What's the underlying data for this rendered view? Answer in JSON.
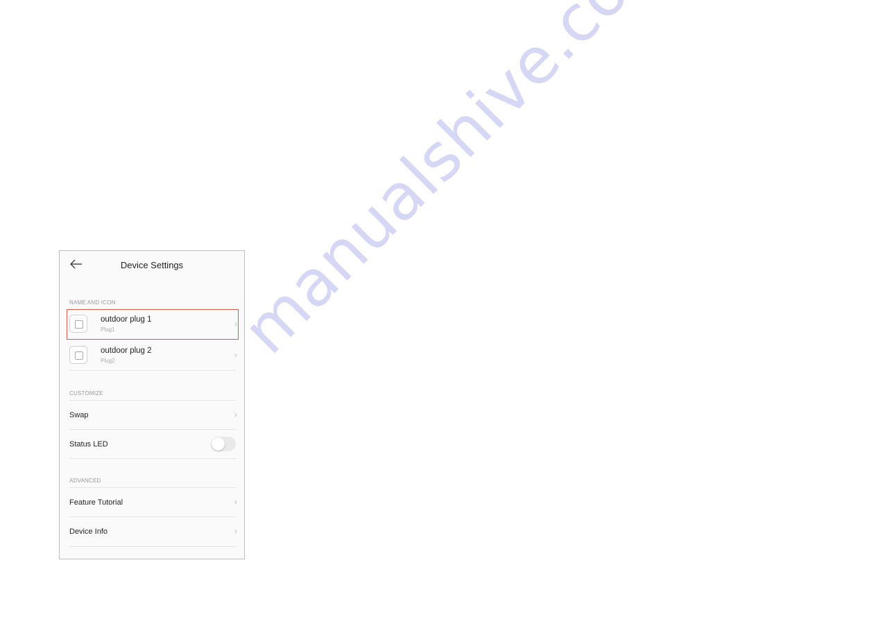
{
  "watermark": "manualshive.com",
  "header": {
    "title": "Device Settings",
    "back_icon": "arrow-left-icon"
  },
  "sections": {
    "name_and_icon": "NAME AND ICON",
    "customize": "CUSTOMIZE",
    "advanced": "ADVANCED"
  },
  "plugs": [
    {
      "name": "outdoor plug 1",
      "sub": "Plug1",
      "icon": "outlet-icon",
      "highlighted": true
    },
    {
      "name": "outdoor plug 2",
      "sub": "Plug2",
      "icon": "outlet-icon",
      "highlighted": false
    }
  ],
  "customize": {
    "swap": "Swap",
    "status_led": "Status LED",
    "status_led_on": false
  },
  "advanced": {
    "feature_tutorial": "Feature Tutorial",
    "device_info": "Device Info"
  },
  "colors": {
    "highlight": "#d9594a",
    "watermark": "#d6d6f5"
  }
}
